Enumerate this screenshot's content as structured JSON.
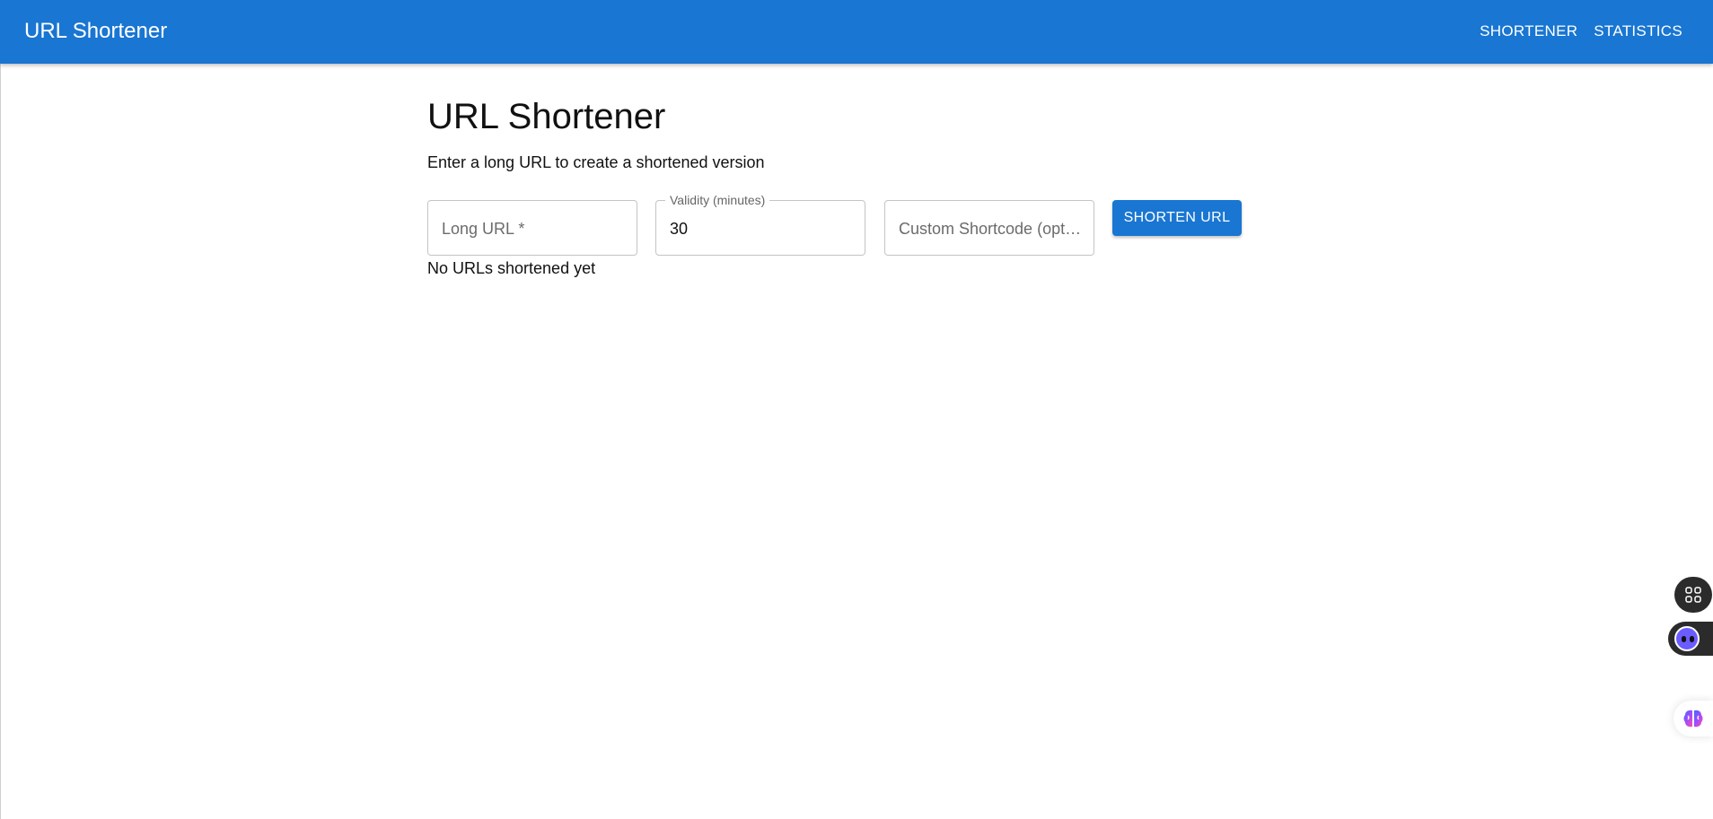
{
  "header": {
    "title": "URL Shortener",
    "nav": [
      {
        "label": "SHORTENER"
      },
      {
        "label": "STATISTICS"
      }
    ],
    "bar_color": "#1976d2"
  },
  "main": {
    "title": "URL Shortener",
    "subtitle": "Enter a long URL to create a shortened version",
    "fields": {
      "long_url": {
        "placeholder": "Long URL *",
        "value": ""
      },
      "validity": {
        "label": "Validity (minutes)",
        "value": "30"
      },
      "shortcode": {
        "placeholder": "Custom Shortcode (optional)",
        "value": ""
      }
    },
    "shorten_button": "SHORTEN URL",
    "empty_message": "No URLs shortened yet"
  },
  "floating_widgets": [
    {
      "icon": "grid-icon"
    },
    {
      "icon": "assistant-bot-icon"
    },
    {
      "icon": "brain-icon"
    }
  ]
}
